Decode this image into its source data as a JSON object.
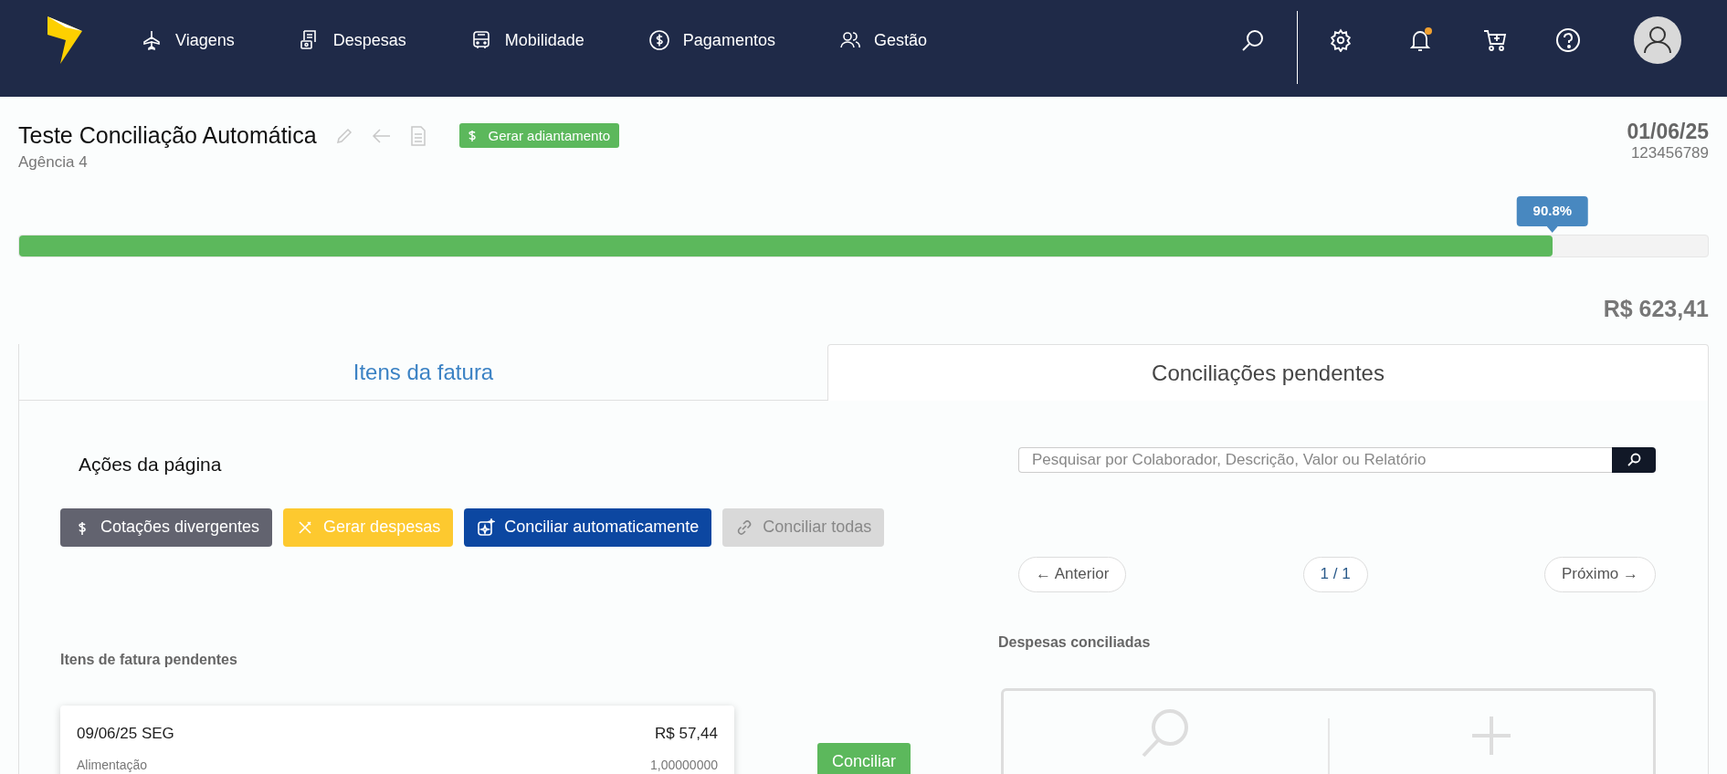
{
  "nav": [
    {
      "label": "Viagens",
      "kind": "plane"
    },
    {
      "label": "Despesas",
      "kind": "receipt"
    },
    {
      "label": "Mobilidade",
      "kind": "bus"
    },
    {
      "label": "Pagamentos",
      "kind": "dollar"
    },
    {
      "label": "Gestão",
      "kind": "users"
    }
  ],
  "report": {
    "title": "Teste Conciliação Automática",
    "subtitle": "Agência 4",
    "advance_button": "Gerar adiantamento",
    "date": "01/06/25",
    "number": "123456789"
  },
  "progress": {
    "level": 0.908,
    "label": "90.8%",
    "amount": "R$ 623,41"
  },
  "tabs": [
    {
      "label": "Itens da fatura",
      "selected": false
    },
    {
      "label": "Conciliações pendentes",
      "selected": true
    }
  ],
  "actions": {
    "title": "Ações da página",
    "buttons": [
      {
        "label": "Cotações divergentes",
        "kind": "dollar",
        "disabled": false
      },
      {
        "label": "Gerar despesas",
        "kind": "cutlery",
        "disabled": false
      },
      {
        "label": "Conciliar automaticamente",
        "kind": "sparkle",
        "disabled": false
      },
      {
        "label": "Conciliar todas",
        "kind": "link",
        "disabled": true
      }
    ]
  },
  "search": {
    "placeholder": "Pesquisar por Colaborador, Descrição, Valor ou Relatório"
  },
  "pagination": {
    "previous": "← Anterior",
    "page": "1 / 1",
    "next": "Próximo →"
  },
  "pending": {
    "title": "Itens de fatura pendentes",
    "items": [
      {
        "date": "09/06/25 SEG",
        "amount": "R$ 57,44",
        "category": "Alimentação",
        "rate": "1,00000000",
        "action": "Conciliar"
      }
    ]
  },
  "reconciled": {
    "title": "Despesas conciliadas"
  }
}
